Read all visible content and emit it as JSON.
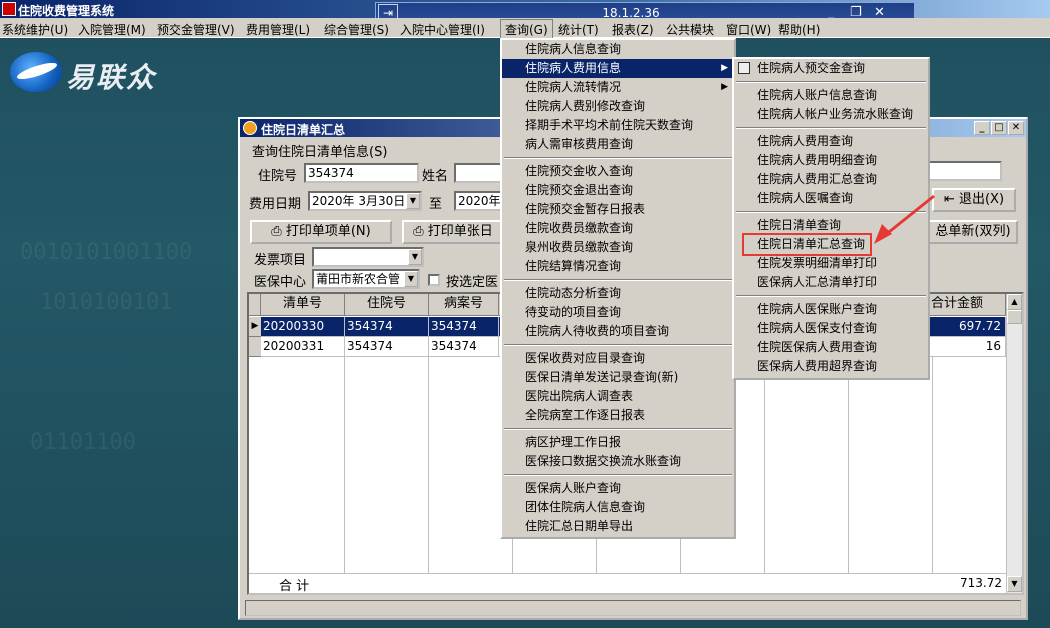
{
  "app": {
    "title": "住院收费管理系统",
    "version": "18.1.2.36",
    "logo_text": "易联众"
  },
  "menubar": [
    "系统维护(U)",
    "入院管理(M)",
    "预交金管理(V)",
    "费用管理(L)",
    "综合管理(S)",
    "入院中心管理(I)",
    "查询(G)",
    "统计(T)",
    "报表(Z)",
    "公共模块",
    "窗口(W)",
    "帮助(H)"
  ],
  "query_menu": {
    "groups": [
      [
        "住院病人信息查询",
        "住院病人费用信息",
        "住院病人流转情况",
        "住院病人费别修改查询",
        "择期手术平均术前住院天数查询",
        "病人需审核费用查询"
      ],
      [
        "住院预交金收入查询",
        "住院预交金退出查询",
        "住院预交金暂存日报表",
        "住院收费员缴款查询",
        "泉州收费员缴款查询",
        "住院结算情况查询"
      ],
      [
        "住院动态分析查询",
        "待变动的项目查询",
        "住院病人待收费的项目查询"
      ],
      [
        "医保收费对应目录查询",
        "医保日清单发送记录查询(新)",
        "医院出院病人调查表",
        "全院病室工作逐日报表"
      ],
      [
        "病区护理工作日报",
        "医保接口数据交换流水账查询"
      ],
      [
        "医保病人账户查询",
        "团体住院病人信息查询",
        "住院汇总日期单导出"
      ]
    ],
    "highlighted": "住院病人费用信息"
  },
  "fee_submenu": {
    "groups": [
      [
        "住院病人预交金查询"
      ],
      [
        "住院病人账户信息查询",
        "住院病人帐户业务流水账查询"
      ],
      [
        "住院病人费用查询",
        "住院病人费用明细查询",
        "住院病人费用汇总查询",
        "住院病人医嘱查询"
      ],
      [
        "住院日清单查询",
        "住院日清单汇总查询",
        "住院发票明细清单打印",
        "医保病人汇总清单打印"
      ],
      [
        "住院病人医保账户查询",
        "住院病人医保支付查询",
        "住院医保病人费用查询",
        "医保病人费用超界查询"
      ]
    ],
    "callout_item": "住院日清单汇总查询"
  },
  "child_window": {
    "title": "住院日清单汇总",
    "group_label": "查询住院日清单信息(S)",
    "inpatient_no_label": "住院号",
    "inpatient_no_value": "354374",
    "name_label": "姓名",
    "name_value": "",
    "fee_date_label": "费用日期",
    "date_from": "2020年 3月30日",
    "to_label": "至",
    "date_to": "2020年",
    "exit_button": "退出(X)",
    "print_item_button": "打印单项单(N)",
    "print_day_button": "打印单张日",
    "summary_new_button": "总单新(双列)",
    "invoice_item_label": "发票项目",
    "insurance_center_label": "医保中心",
    "insurance_center_value": "莆田市新农合管",
    "checkbox_label": "按选定医",
    "grid": {
      "columns": [
        "清单号",
        "住院号",
        "病案号",
        "",
        "",
        "",
        "",
        "",
        "合计金额"
      ],
      "rows": [
        {
          "list_no": "20200330",
          "inpatient_no": "354374",
          "case_no": "354374",
          "total": "697.72",
          "selected": true
        },
        {
          "list_no": "20200331",
          "inpatient_no": "354374",
          "case_no": "354374",
          "total": "16",
          "selected": false
        }
      ],
      "footer_label": "合 计",
      "footer_total": "713.72"
    }
  },
  "colors": {
    "highlight": "#0a246a",
    "callout": "#e53935",
    "desktop": "#235866"
  }
}
